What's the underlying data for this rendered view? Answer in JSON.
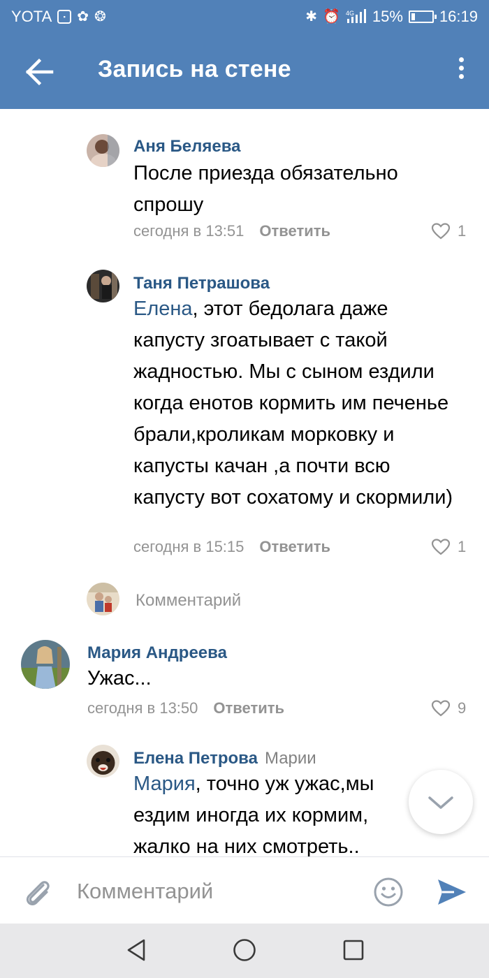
{
  "statusbar": {
    "carrier": "YOTA",
    "battery": "15%",
    "battery_level": 0.15,
    "time": "16:19",
    "network": "4G"
  },
  "header": {
    "title": "Запись на стене",
    "back_icon": "arrow-left-icon",
    "menu_icon": "more-vertical-icon"
  },
  "comments": [
    {
      "author": "Аня Беляева",
      "text": "После приезда обязательно спрошу",
      "time": "сегодня в 13:51",
      "reply": "Ответить",
      "likes": "1"
    },
    {
      "author": "Таня Петрашова",
      "mention": "Елена",
      "text": ", этот бедолага даже капусту згоатывает с такой жадностью. Мы с сыном ездили когда енотов кормить им печенье брали,кроликам морковку и капусты качан ,а почти всю капусту вот сохатому и скормили)",
      "time": "сегодня в 15:15",
      "reply": "Ответить",
      "likes": "1"
    },
    {
      "author": "Мария Андреева",
      "text": "Ужас...",
      "time": "сегодня в 13:50",
      "reply": "Ответить",
      "likes": "9"
    },
    {
      "author": "Елена Петрова",
      "reply_to": "Марии",
      "mention": "Мария",
      "text": ", точно уж ужас,мы ездим иногда их кормим, жалко на них смотреть.."
    }
  ],
  "reply_prompt": {
    "label": "Комментарий"
  },
  "composer": {
    "placeholder": "Комментарий",
    "attach_icon": "paperclip-icon",
    "emoji_icon": "smile-icon",
    "send_icon": "send-icon"
  },
  "colors": {
    "brand_blue": "#5181b8",
    "link_blue": "#2a5885",
    "meta_gray": "#939393"
  }
}
